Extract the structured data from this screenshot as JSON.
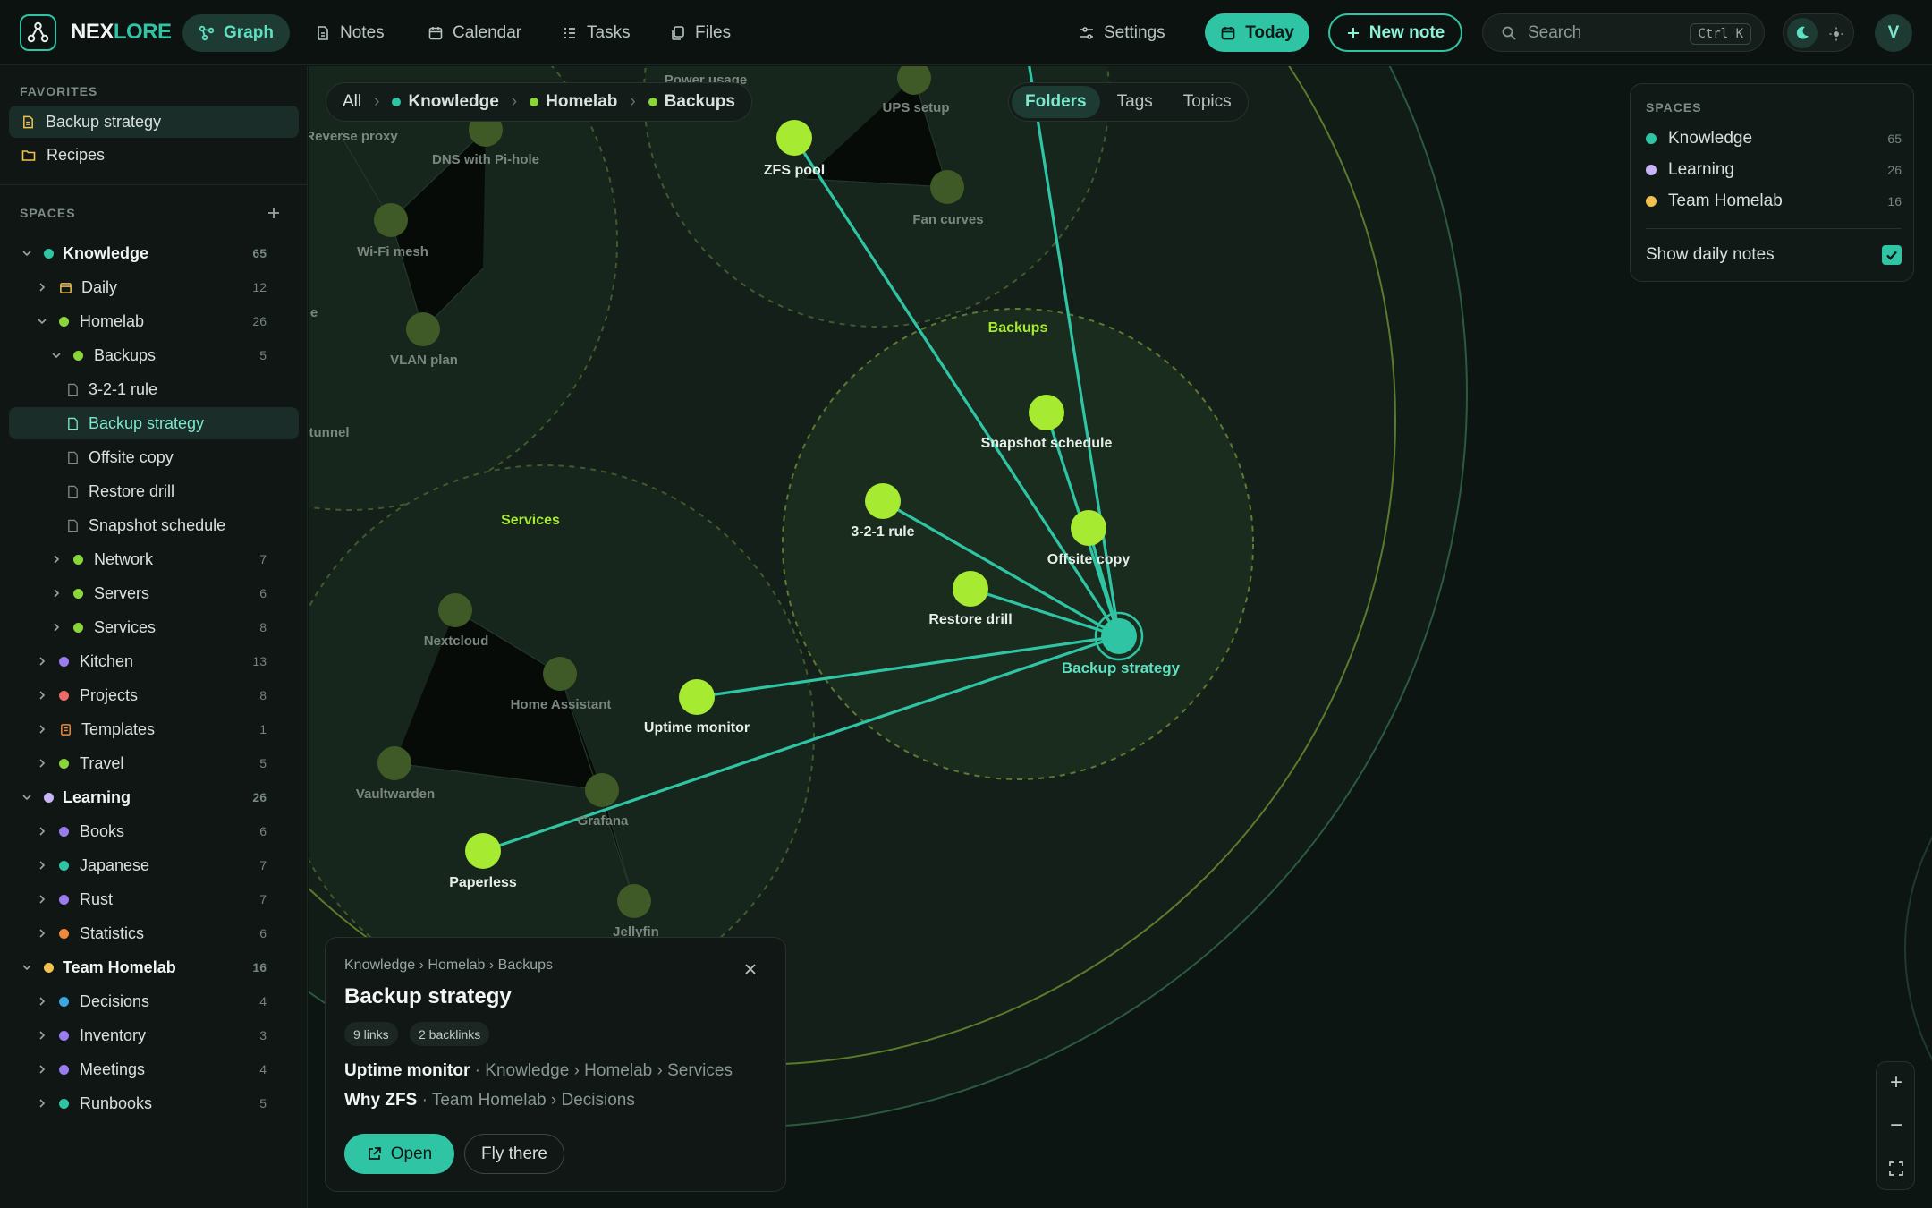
{
  "brand": {
    "part1": "NEX",
    "part2": "LORE"
  },
  "nav": [
    {
      "label": "Graph",
      "icon": "graph-icon",
      "active": true
    },
    {
      "label": "Notes",
      "icon": "note-icon"
    },
    {
      "label": "Calendar",
      "icon": "calendar-icon"
    },
    {
      "label": "Tasks",
      "icon": "tasks-icon"
    },
    {
      "label": "Files",
      "icon": "files-icon"
    },
    {
      "label": "Settings",
      "icon": "sliders-icon"
    }
  ],
  "actions": {
    "today": "Today",
    "new_note": "New note"
  },
  "search": {
    "placeholder": "Search",
    "shortcut": "Ctrl K"
  },
  "user": {
    "initial": "V"
  },
  "sidebar": {
    "favorites_title": "FAVORITES",
    "favorites": [
      {
        "label": "Backup strategy",
        "icon": "note-icon",
        "active": true
      },
      {
        "label": "Recipes",
        "icon": "folder-icon"
      }
    ],
    "spaces_title": "SPACES",
    "tree": [
      {
        "label": "Knowledge",
        "count": "65",
        "color": "#2fc4a4"
      },
      {
        "label": "Daily",
        "count": "12"
      },
      {
        "label": "Homelab",
        "count": "26",
        "color": "#8ad63a"
      },
      {
        "label": "Backups",
        "count": "5",
        "color": "#8ad63a"
      },
      {
        "label": "3-2-1 rule"
      },
      {
        "label": "Backup strategy",
        "active": true
      },
      {
        "label": "Offsite copy"
      },
      {
        "label": "Restore drill"
      },
      {
        "label": "Snapshot schedule"
      },
      {
        "label": "Network",
        "count": "7",
        "color": "#8ad63a"
      },
      {
        "label": "Servers",
        "count": "6",
        "color": "#8ad63a"
      },
      {
        "label": "Services",
        "count": "8",
        "color": "#8ad63a"
      },
      {
        "label": "Kitchen",
        "count": "13",
        "color": "#9b7cf0"
      },
      {
        "label": "Projects",
        "count": "8",
        "color": "#f06a6a"
      },
      {
        "label": "Templates",
        "count": "1"
      },
      {
        "label": "Travel",
        "count": "5",
        "color": "#8ad63a"
      },
      {
        "label": "Learning",
        "count": "26",
        "color": "#c7b5f5"
      },
      {
        "label": "Books",
        "count": "6",
        "color": "#9b7cf0"
      },
      {
        "label": "Japanese",
        "count": "7",
        "color": "#2fc4a4"
      },
      {
        "label": "Rust",
        "count": "7",
        "color": "#9b7cf0"
      },
      {
        "label": "Statistics",
        "count": "6",
        "color": "#f08a3a"
      },
      {
        "label": "Team Homelab",
        "count": "16",
        "color": "#f2c14e"
      },
      {
        "label": "Decisions",
        "count": "4",
        "color": "#3aa7e0"
      },
      {
        "label": "Inventory",
        "count": "3",
        "color": "#9b7cf0"
      },
      {
        "label": "Meetings",
        "count": "4",
        "color": "#9b7cf0"
      },
      {
        "label": "Runbooks",
        "count": "5",
        "color": "#2fc4a4"
      }
    ]
  },
  "breadcrumb": {
    "all": "All",
    "items": [
      "Knowledge",
      "Homelab",
      "Backups"
    ]
  },
  "view_tabs": [
    {
      "label": "Folders",
      "active": true
    },
    {
      "label": "Tags"
    },
    {
      "label": "Topics"
    }
  ],
  "spaces_panel": {
    "title": "SPACES",
    "items": [
      {
        "label": "Knowledge",
        "count": "65",
        "color": "#2fc4a4"
      },
      {
        "label": "Learning",
        "count": "26",
        "color": "#c7b5f5"
      },
      {
        "label": "Team Homelab",
        "count": "16",
        "color": "#f2c14e"
      }
    ],
    "daily_label": "Show daily notes",
    "daily_checked": true
  },
  "graph": {
    "cluster_labels": [
      "Backups",
      "Services"
    ],
    "nodes": [
      {
        "label": "ZFS pool"
      },
      {
        "label": "Snapshot schedule"
      },
      {
        "label": "3-2-1 rule"
      },
      {
        "label": "Offsite copy"
      },
      {
        "label": "Restore drill"
      },
      {
        "label": "Backup strategy"
      },
      {
        "label": "Uptime monitor"
      },
      {
        "label": "Paperless"
      },
      {
        "label": "UPS setup"
      },
      {
        "label": "Fan curves"
      },
      {
        "label": "DNS with Pi-hole"
      },
      {
        "label": "Wi-Fi mesh"
      },
      {
        "label": "VLAN plan"
      },
      {
        "label": "Nextcloud"
      },
      {
        "label": "Home Assistant"
      },
      {
        "label": "Vaultwarden"
      },
      {
        "label": "Grafana"
      },
      {
        "label": "Jellyfin"
      }
    ],
    "partial_labels": [
      "Power usage",
      "Reverse proxy",
      "e",
      "tunnel"
    ]
  },
  "card": {
    "path": "Knowledge › Homelab › Backups",
    "title": "Backup strategy",
    "links": "9 links",
    "backlinks": "2 backlinks",
    "link_list": [
      {
        "name": "Uptime monitor",
        "path": "· Knowledge › Homelab › Services"
      },
      {
        "name": "Why ZFS",
        "path": "· Team Homelab › Decisions"
      }
    ],
    "open": "Open",
    "fly": "Fly there"
  },
  "zoom": {
    "in": "+",
    "out": "−"
  }
}
